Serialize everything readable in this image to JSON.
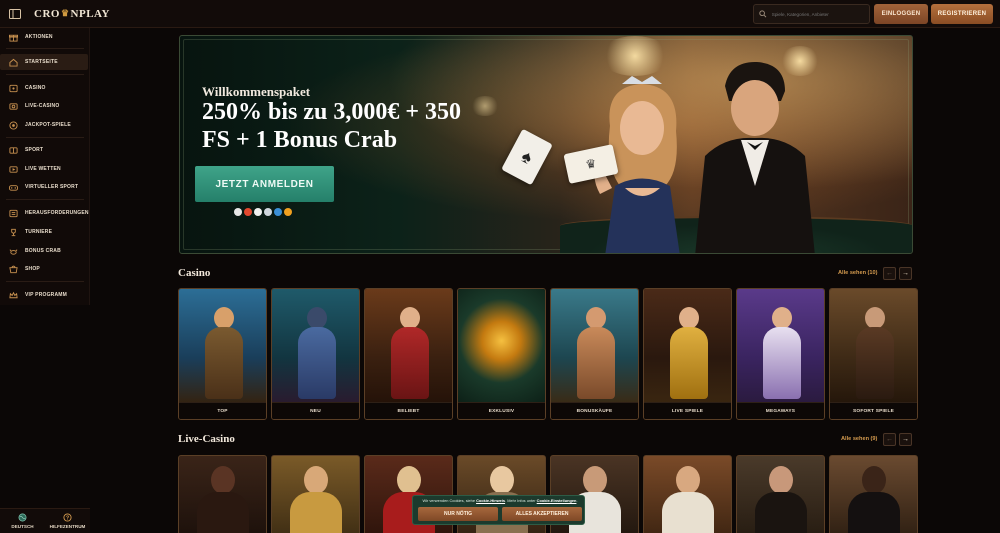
{
  "header": {
    "logo_text_left": "CRO",
    "logo_text_right": "NPLAY",
    "search_placeholder": "Spiele, Kategorien, Anbieter",
    "login_label": "EINLOGGEN",
    "register_label": "REGISTRIEREN"
  },
  "sidebar": {
    "items": [
      {
        "label": "AKTIONEN",
        "icon": "gift-icon"
      },
      {
        "label": "STARTSEITE",
        "icon": "home-icon",
        "active": true
      },
      {
        "label": "CASINO",
        "icon": "casino-icon"
      },
      {
        "label": "LIVE-CASINO",
        "icon": "live-casino-icon"
      },
      {
        "label": "JACKPOT-SPIELE",
        "icon": "jackpot-icon"
      },
      {
        "label": "SPORT",
        "icon": "sport-icon"
      },
      {
        "label": "LIVE WETTEN",
        "icon": "live-bet-icon"
      },
      {
        "label": "VIRTUELLER SPORT",
        "icon": "virtual-sport-icon"
      },
      {
        "label": "HERAUSFORDERUNGEN",
        "icon": "challenge-icon"
      },
      {
        "label": "TURNIERE",
        "icon": "trophy-icon"
      },
      {
        "label": "BONUS CRAB",
        "icon": "crab-icon"
      },
      {
        "label": "SHOP",
        "icon": "shop-icon"
      },
      {
        "label": "VIP PROGRAMM",
        "icon": "crown-icon"
      }
    ],
    "bottom": {
      "language_label": "DEUTSCH",
      "help_label": "HILFEZENTRUM"
    }
  },
  "hero": {
    "kicker": "Willkommenspaket",
    "title": "250% bis zu 3,000€ + 350 FS + 1 Bonus Crab",
    "cta": "JETZT ANMELDEN"
  },
  "casino": {
    "title": "Casino",
    "see_all": "Alle sehen (10)",
    "cards": [
      {
        "label": "TOP"
      },
      {
        "label": "NEU"
      },
      {
        "label": "BELIEBT"
      },
      {
        "label": "EXKLUSIV"
      },
      {
        "label": "BONUSKÄUFE"
      },
      {
        "label": "LIVE SPIELE"
      },
      {
        "label": "MEGAWAYS"
      },
      {
        "label": "SOFORT SPIELE"
      }
    ]
  },
  "live_casino": {
    "title": "Live-Casino",
    "see_all": "Alle sehen (9)"
  },
  "cookie": {
    "text_1": "Wir verwenden Cookies, siehe ",
    "link_1": "Cookie-Hinweis",
    "text_2": ". Mehr Infos unter ",
    "link_2": "Cookie-Einstellungen",
    "text_3": ".",
    "btn_necessary": "NUR NÖTIG",
    "btn_accept": "ALLES AKZEPTIEREN"
  },
  "colors": {
    "accent_gold": "#d59b4f",
    "cta_green": "#3fa489",
    "button_bronze": "#a2633a"
  }
}
